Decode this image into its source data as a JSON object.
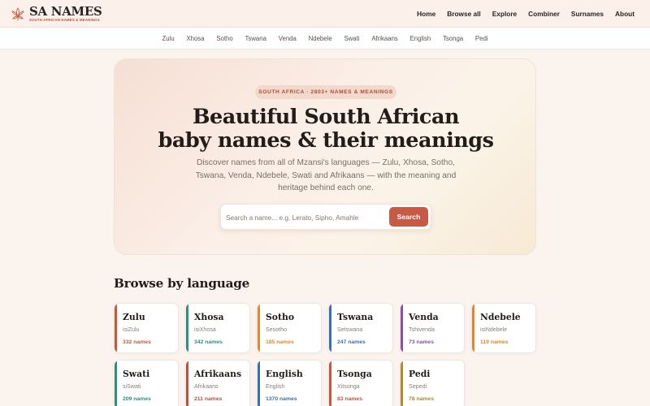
{
  "brand": {
    "title": "SA NAMES",
    "subtitle": "SOUTH AFRICAN NAMES & MEANINGS",
    "accent": "#c75a45"
  },
  "nav": [
    "Home",
    "Browse all",
    "Explore",
    "Combiner",
    "Surnames",
    "About"
  ],
  "languages_bar": [
    "Zulu",
    "Xhosa",
    "Sotho",
    "Tswana",
    "Venda",
    "Ndebele",
    "Swati",
    "Afrikaans",
    "English",
    "Tsonga",
    "Pedi"
  ],
  "hero": {
    "badge": "SOUTH AFRICA · 2803+ NAMES & MEANINGS",
    "title_line1": "Beautiful South African",
    "title_line2": "baby names & their meanings",
    "description": "Discover names from all of Mzansi's languages — Zulu, Xhosa, Sotho, Tswana, Venda, Ndebele, Swati and Afrikaans — with the meaning and heritage behind each one.",
    "search_placeholder": "Search a name... e.g. Lerato, Sipho, Amahle",
    "search_value": "",
    "search_button": "Search"
  },
  "browse": {
    "title": "Browse by language",
    "cards": [
      {
        "name": "Zulu",
        "native": "isiZulu",
        "count": "332 names",
        "color": "#c9553f"
      },
      {
        "name": "Xhosa",
        "native": "isiXhosa",
        "count": "342 names",
        "color": "#2f8f7e"
      },
      {
        "name": "Sotho",
        "native": "Sesotho",
        "count": "185 names",
        "color": "#e08a2c"
      },
      {
        "name": "Tswana",
        "native": "Setswana",
        "count": "247 names",
        "color": "#3c6fb0"
      },
      {
        "name": "Venda",
        "native": "Tshivenda",
        "count": "73 names",
        "color": "#8a4fae"
      },
      {
        "name": "Ndebele",
        "native": "isiNdebele",
        "count": "119 names",
        "color": "#e0862c"
      },
      {
        "name": "Swati",
        "native": "siSwati",
        "count": "209 names",
        "color": "#2f8f7e"
      },
      {
        "name": "Afrikaans",
        "native": "Afrikaans",
        "count": "211 names",
        "color": "#b5533f"
      },
      {
        "name": "English",
        "native": "English",
        "count": "1370 names",
        "color": "#3c6fb0"
      },
      {
        "name": "Tsonga",
        "native": "Xitsonga",
        "count": "83 names",
        "color": "#c9553f"
      },
      {
        "name": "Pedi",
        "native": "Sepedi",
        "count": "78 names",
        "color": "#b08a2c"
      }
    ]
  }
}
